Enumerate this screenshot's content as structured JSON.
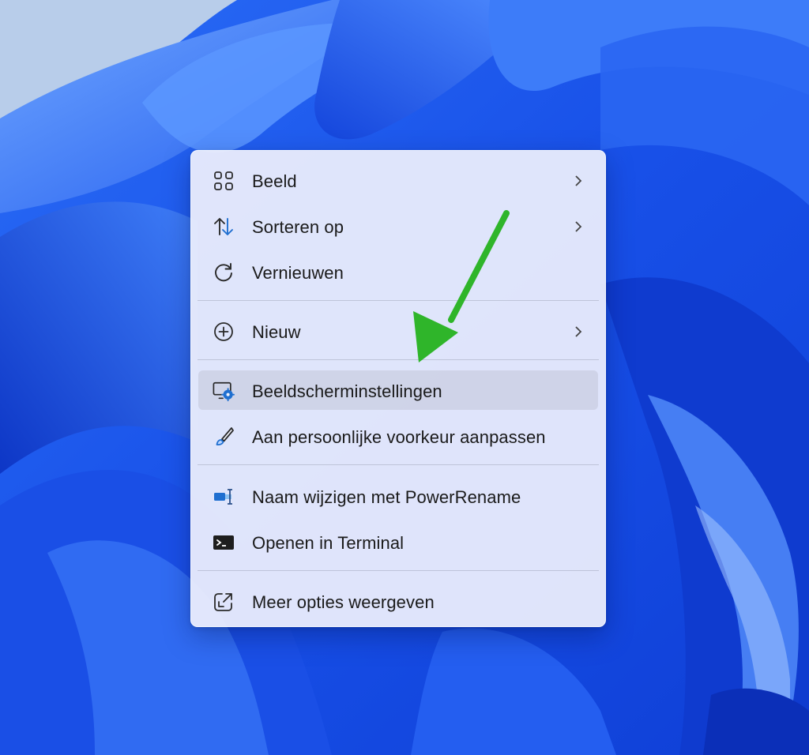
{
  "menu": {
    "items": [
      {
        "label": "Beeld",
        "icon": "view-grid-icon",
        "submenu": true
      },
      {
        "label": "Sorteren op",
        "icon": "sort-arrows-icon",
        "submenu": true
      },
      {
        "label": "Vernieuwen",
        "icon": "refresh-icon",
        "submenu": false
      },
      {
        "label": "Nieuw",
        "icon": "new-plus-icon",
        "submenu": true
      },
      {
        "label": "Beeldscherminstellingen",
        "icon": "display-settings-icon",
        "submenu": false,
        "highlighted": true
      },
      {
        "label": "Aan persoonlijke voorkeur aanpassen",
        "icon": "personalize-brush-icon",
        "submenu": false
      },
      {
        "label": "Naam wijzigen met PowerRename",
        "icon": "powerrename-icon",
        "submenu": false
      },
      {
        "label": "Openen in Terminal",
        "icon": "terminal-icon",
        "submenu": false
      },
      {
        "label": "Meer opties weergeven",
        "icon": "more-options-icon",
        "submenu": false
      }
    ]
  },
  "colors": {
    "wallpaper_blue": "#1c5cf2",
    "arrow_green": "#2fb52a",
    "icon_accent": "#1f6fd0"
  }
}
